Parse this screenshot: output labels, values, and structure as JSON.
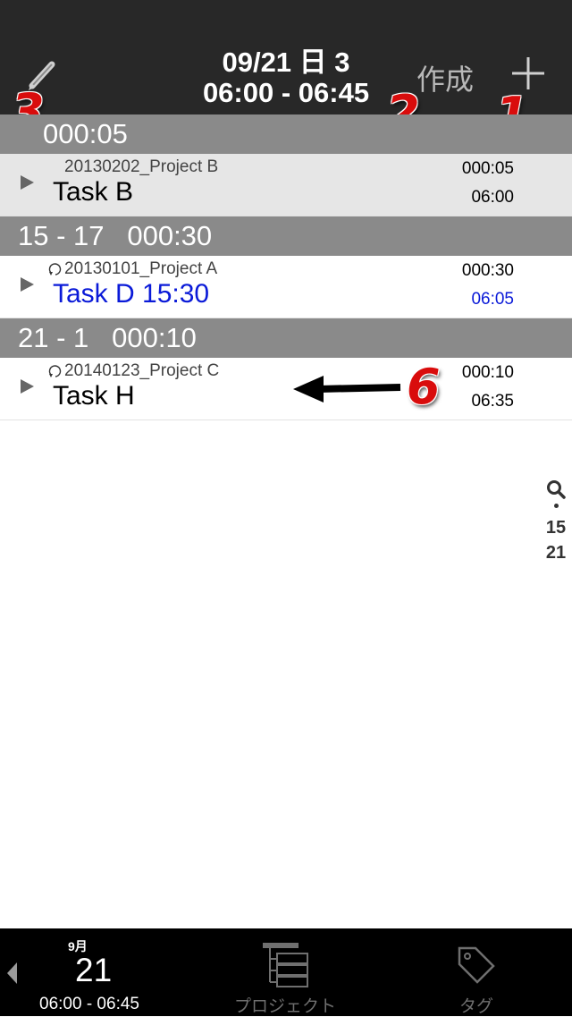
{
  "header": {
    "date": "09/21 日 3",
    "time_range": "06:00 - 06:45",
    "create_label": "作成"
  },
  "badges": {
    "b1": "1",
    "b2": "2",
    "b3": "3",
    "b6": "6"
  },
  "sections": [
    {
      "label": "000:05",
      "rows": [
        {
          "project": "20130202_Project B",
          "task": "Task B",
          "duration": "000:05",
          "start": "06:00",
          "repeat": false,
          "highlight": false
        }
      ]
    },
    {
      "label": "15 - 17   000:30",
      "rows": [
        {
          "project": "20130101_Project A",
          "task": "Task D 15:30",
          "duration": "000:30",
          "start": "06:05",
          "repeat": true,
          "highlight": true
        }
      ]
    },
    {
      "label": "21 - 1   000:10",
      "rows": [
        {
          "project": "20140123_Project C",
          "task": "Task H",
          "duration": "000:10",
          "start": "06:35",
          "repeat": true,
          "highlight": false
        }
      ]
    }
  ],
  "index": [
    "15",
    "21"
  ],
  "tabbar": {
    "month": "9月",
    "day": "21",
    "range": "06:00 - 06:45",
    "project_label": "プロジェクト",
    "tag_label": "タグ"
  },
  "colors": {
    "header_bg": "#282828",
    "section_bg": "#8a8a8a",
    "selected_row_bg": "#e6e6e6",
    "highlight_text": "#0a1ad8",
    "badge_red": "#d90c0c"
  },
  "icons": [
    "pencil-icon",
    "plus-icon",
    "repeat-icon",
    "search-icon",
    "project-tree-icon",
    "tag-icon",
    "back-arrow-icon",
    "annotation-arrow-icon"
  ]
}
